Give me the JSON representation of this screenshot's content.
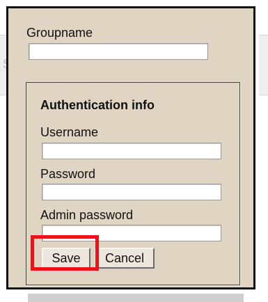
{
  "background": {
    "left_fragment": "S"
  },
  "dialog": {
    "groupname_label": "Groupname",
    "groupname_value": "",
    "auth": {
      "legend": "Authentication info",
      "username_label": "Username",
      "username_value": "",
      "password_label": "Password",
      "password_value": "",
      "admin_password_label": "Admin password",
      "admin_password_value": ""
    },
    "buttons": {
      "save_label": "Save",
      "cancel_label": "Cancel"
    }
  },
  "colors": {
    "dialog_bg": "#e0d4c2",
    "highlight": "#e8141a"
  }
}
